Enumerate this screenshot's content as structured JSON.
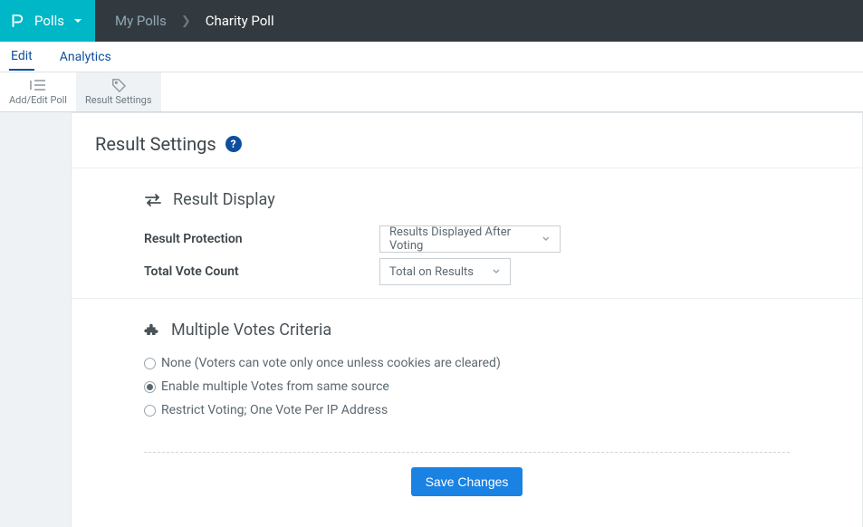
{
  "brand": {
    "label": "Polls"
  },
  "breadcrumb": {
    "parent": "My Polls",
    "current": "Charity Poll"
  },
  "subnav": {
    "edit": "Edit",
    "analytics": "Analytics",
    "active": "edit"
  },
  "toolbar": {
    "add_edit": "Add/Edit Poll",
    "result_settings": "Result Settings",
    "active": "result_settings"
  },
  "page": {
    "title": "Result Settings"
  },
  "section_display": {
    "title": "Result Display",
    "result_protection_label": "Result Protection",
    "result_protection_value": "Results Displayed After Voting",
    "total_vote_label": "Total Vote Count",
    "total_vote_value": "Total on Results"
  },
  "section_multi": {
    "title": "Multiple Votes Criteria",
    "options": {
      "none": "None (Voters can vote only once unless cookies are cleared)",
      "enable": "Enable multiple Votes from same source",
      "restrict": "Restrict Voting; One Vote Per IP Address"
    },
    "selected": "enable"
  },
  "actions": {
    "save": "Save Changes"
  }
}
